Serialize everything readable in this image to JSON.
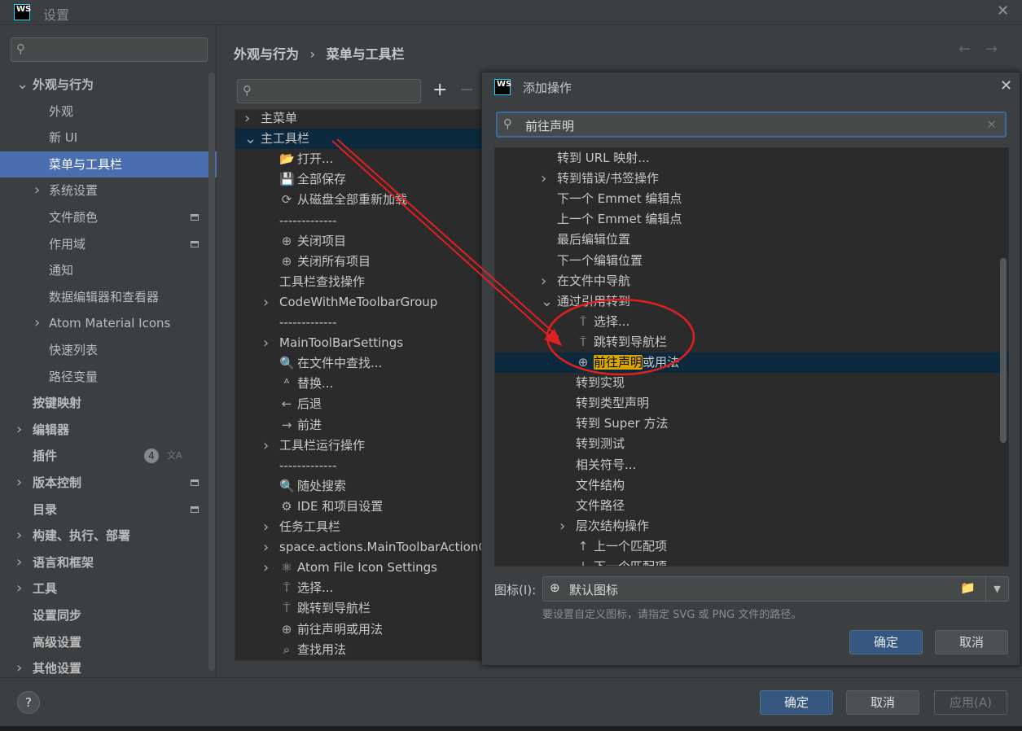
{
  "window": {
    "title": "设置",
    "logo": "WS"
  },
  "sidebar": {
    "items": [
      {
        "label": "外观与行为",
        "level": 0,
        "chev": "down",
        "bold": true
      },
      {
        "label": "外观",
        "level": 1
      },
      {
        "label": "新 UI",
        "level": 1
      },
      {
        "label": "菜单与工具栏",
        "level": 1,
        "selected": true
      },
      {
        "label": "系统设置",
        "level": 1,
        "chev": "right"
      },
      {
        "label": "文件颜色",
        "level": 1,
        "mini": true
      },
      {
        "label": "作用域",
        "level": 1,
        "mini": true
      },
      {
        "label": "通知",
        "level": 1
      },
      {
        "label": "数据编辑器和查看器",
        "level": 1
      },
      {
        "label": "Atom Material Icons",
        "level": 1,
        "chev": "right"
      },
      {
        "label": "快速列表",
        "level": 1
      },
      {
        "label": "路径变量",
        "level": 1
      },
      {
        "label": "按键映射",
        "level": 0,
        "bold": true
      },
      {
        "label": "编辑器",
        "level": 0,
        "chev": "right",
        "bold": true
      },
      {
        "label": "插件",
        "level": 0,
        "bold": true,
        "badge": "4"
      },
      {
        "label": "版本控制",
        "level": 0,
        "chev": "right",
        "bold": true,
        "mini": true
      },
      {
        "label": "目录",
        "level": 0,
        "bold": true,
        "mini": true
      },
      {
        "label": "构建、执行、部署",
        "level": 0,
        "chev": "right",
        "bold": true
      },
      {
        "label": "语言和框架",
        "level": 0,
        "chev": "right",
        "bold": true
      },
      {
        "label": "工具",
        "level": 0,
        "chev": "right",
        "bold": true
      },
      {
        "label": "设置同步",
        "level": 0,
        "bold": true
      },
      {
        "label": "高级设置",
        "level": 0,
        "bold": true
      },
      {
        "label": "其他设置",
        "level": 0,
        "chev": "right",
        "bold": true
      }
    ]
  },
  "breadcrumb": {
    "parent": "外观与行为",
    "sep": "›",
    "current": "菜单与工具栏"
  },
  "tree": {
    "rows": [
      {
        "label": "主菜单",
        "level": 0,
        "chev": "right"
      },
      {
        "label": "主工具栏",
        "level": 0,
        "chev": "down",
        "selected": true
      },
      {
        "label": "打开...",
        "level": 1,
        "icon": "📂"
      },
      {
        "label": "全部保存",
        "level": 1,
        "icon": "💾"
      },
      {
        "label": "从磁盘全部重新加载",
        "level": 1,
        "icon": "⟳"
      },
      {
        "label": "-------------",
        "level": 1
      },
      {
        "label": "关闭项目",
        "level": 1,
        "icon": "⊕"
      },
      {
        "label": "关闭所有项目",
        "level": 1,
        "icon": "⊕"
      },
      {
        "label": "工具栏查找操作",
        "level": 1
      },
      {
        "label": "CodeWithMeToolbarGroup",
        "level": 1,
        "chev": "right"
      },
      {
        "label": "-------------",
        "level": 1
      },
      {
        "label": "MainToolBarSettings",
        "level": 1,
        "chev": "right"
      },
      {
        "label": "在文件中查找...",
        "level": 1,
        "icon": "🔍"
      },
      {
        "label": "替换...",
        "level": 1,
        "icon": "ᴬ"
      },
      {
        "label": "后退",
        "level": 1,
        "icon": "←"
      },
      {
        "label": "前进",
        "level": 1,
        "icon": "→"
      },
      {
        "label": "工具栏运行操作",
        "level": 1,
        "chev": "right"
      },
      {
        "label": "-------------",
        "level": 1
      },
      {
        "label": "随处搜索",
        "level": 1,
        "icon": "🔍"
      },
      {
        "label": "IDE 和项目设置",
        "level": 1,
        "icon": "⚙"
      },
      {
        "label": "任务工具栏",
        "level": 1,
        "chev": "right"
      },
      {
        "label": "space.actions.MainToolbarActionGroup",
        "level": 1,
        "chev": "right"
      },
      {
        "label": "Atom File Icon Settings",
        "level": 1,
        "chev": "right",
        "icon": "⚛"
      },
      {
        "label": "选择...",
        "level": 1,
        "icon": "⍑"
      },
      {
        "label": "跳转到导航栏",
        "level": 1,
        "icon": "⍑"
      },
      {
        "label": "前往声明或用法",
        "level": 1,
        "icon": "⊕"
      },
      {
        "label": "查找用法",
        "level": 1,
        "icon": "⌕"
      }
    ]
  },
  "dialog": {
    "title": "添加操作",
    "logo": "WS",
    "search_value": "前往声明",
    "rows": [
      {
        "label": "转到 URL 映射...",
        "level": 1
      },
      {
        "label": "转到错误/书签操作",
        "level": 1,
        "chev": "right"
      },
      {
        "label": "下一个 Emmet 编辑点",
        "level": 1
      },
      {
        "label": "上一个 Emmet 编辑点",
        "level": 1
      },
      {
        "label": "最后编辑位置",
        "level": 1
      },
      {
        "label": "下一个编辑位置",
        "level": 1
      },
      {
        "label": "在文件中导航",
        "level": 1,
        "chev": "right"
      },
      {
        "label": "通过引用转到",
        "level": 1,
        "chev": "down"
      },
      {
        "label": "选择...",
        "level": 2,
        "icon": "⍑"
      },
      {
        "label": "跳转到导航栏",
        "level": 2,
        "icon": "⍑"
      },
      {
        "label": "或用法",
        "level": 2,
        "icon": "⊕",
        "highlight": "前往声明",
        "selected": true
      },
      {
        "label": "转到实现",
        "level": 2
      },
      {
        "label": "转到类型声明",
        "level": 2
      },
      {
        "label": "转到 Super 方法",
        "level": 2
      },
      {
        "label": "转到测试",
        "level": 2
      },
      {
        "label": "相关符号...",
        "level": 2
      },
      {
        "label": "文件结构",
        "level": 2
      },
      {
        "label": "文件路径",
        "level": 2
      },
      {
        "label": "层次结构操作",
        "level": 2,
        "chev": "right"
      },
      {
        "label": "上一个匹配项",
        "level": 2,
        "icon": "↑"
      },
      {
        "label": "下一个匹配项",
        "level": 2,
        "icon": "↓"
      }
    ],
    "icon_label": "图标(I):",
    "icon_value": "默认图标",
    "hint": "要设置自定义图标，请指定 SVG 或 PNG 文件的路径。",
    "ok": "确定",
    "cancel": "取消"
  },
  "footer": {
    "ok": "确定",
    "cancel": "取消",
    "apply": "应用(A)",
    "help": "?"
  },
  "colors": {
    "accent": "#4b6eaf",
    "primary_button": "#365880",
    "annotation": "#e02020"
  }
}
